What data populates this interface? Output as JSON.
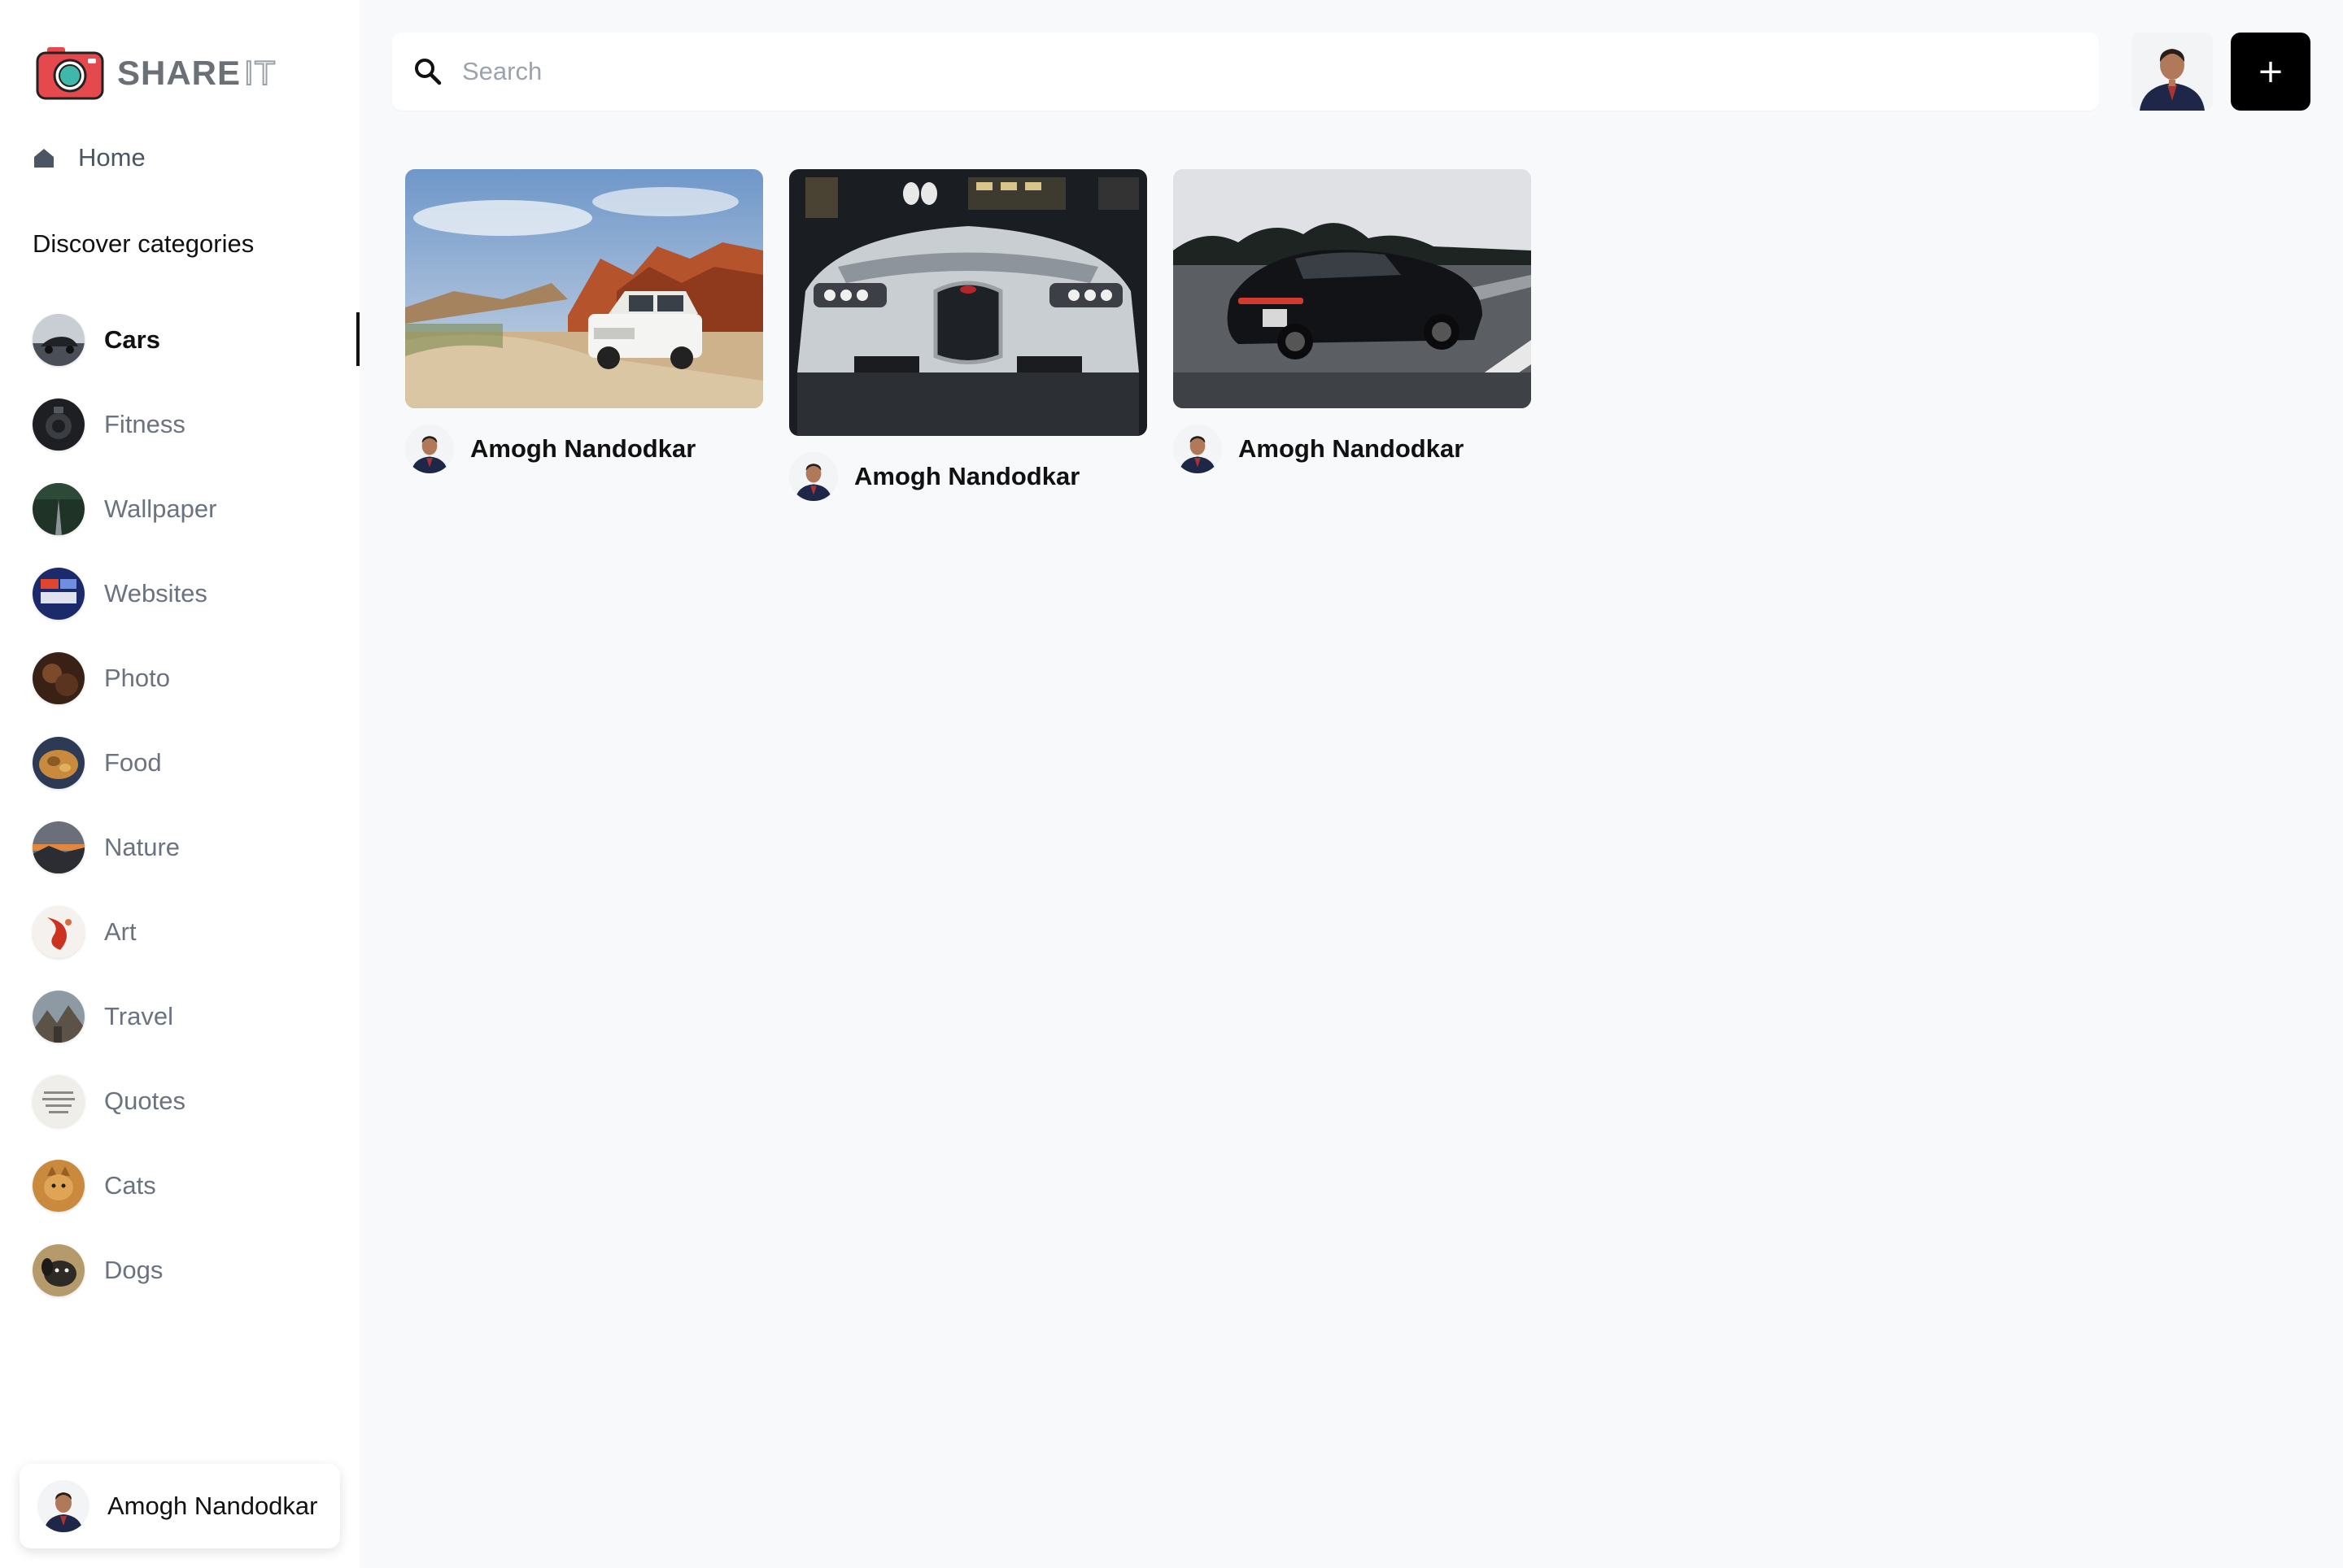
{
  "app": {
    "logo_text": "SHARE",
    "logo_text_outline": "IT"
  },
  "sidebar": {
    "home_label": "Home",
    "discover_title": "Discover categories",
    "categories": [
      {
        "label": "Cars",
        "active": true
      },
      {
        "label": "Fitness",
        "active": false
      },
      {
        "label": "Wallpaper",
        "active": false
      },
      {
        "label": "Websites",
        "active": false
      },
      {
        "label": "Photo",
        "active": false
      },
      {
        "label": "Food",
        "active": false
      },
      {
        "label": "Nature",
        "active": false
      },
      {
        "label": "Art",
        "active": false
      },
      {
        "label": "Travel",
        "active": false
      },
      {
        "label": "Quotes",
        "active": false
      },
      {
        "label": "Cats",
        "active": false
      },
      {
        "label": "Dogs",
        "active": false
      }
    ],
    "user_name": "Amogh Nandodkar"
  },
  "search": {
    "placeholder": "Search",
    "value": ""
  },
  "toolbar": {
    "add_label": "+"
  },
  "pins": [
    {
      "author": "Amogh Nandodkar",
      "image": "white-suv-desert"
    },
    {
      "author": "Amogh Nandodkar",
      "image": "silver-hypercar-front"
    },
    {
      "author": "Amogh Nandodkar",
      "image": "black-sedan-road"
    }
  ],
  "colors": {
    "accent": "#000000",
    "background": "#f8f9fb",
    "sidebar_bg": "#ffffff",
    "logo_red": "#e5484d",
    "logo_teal": "#3fb8a9"
  }
}
